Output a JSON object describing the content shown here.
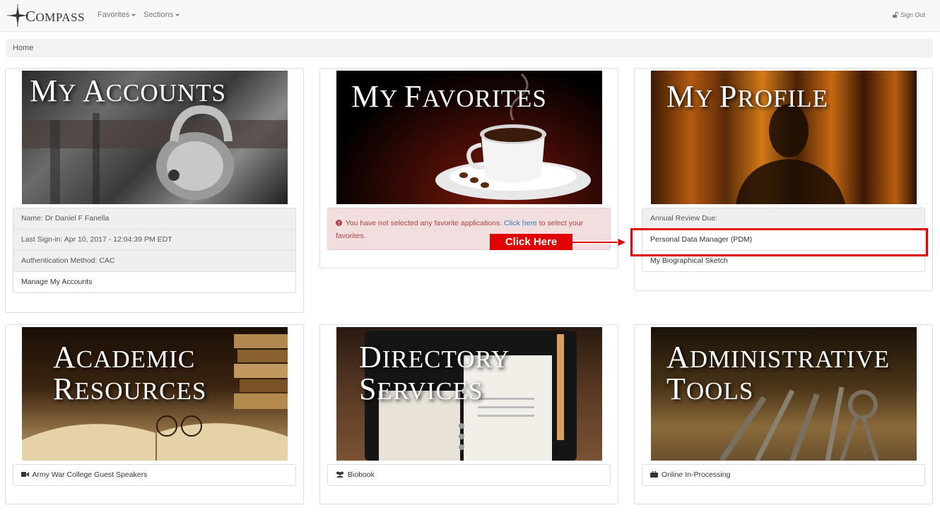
{
  "navbar": {
    "brand_first": "C",
    "brand_rest": "OMPASS",
    "menu_favorites": "Favorites",
    "menu_sections": "Sections",
    "signout": "Sign Out"
  },
  "breadcrumb": {
    "home": "Home"
  },
  "panels": {
    "accounts": {
      "title": "My Accounts",
      "name": "Name: Dr Daniel F Fanella",
      "last_signin": "Last Sign-in: Apr 10, 2017 - 12:04:39 PM EDT",
      "auth": "Authentication Method: CAC",
      "manage": "Manage My Accounts"
    },
    "favorites": {
      "title": "My Favorites",
      "alert_pre": "You have not selected any favorite applications.",
      "alert_link": "Click here",
      "alert_post": "to select your favorites."
    },
    "profile": {
      "title": "My Profile",
      "annual_review": "Annual Review Due:",
      "pdm": "Personal Data Manager (PDM)",
      "bio": "My Biographical Sketch"
    },
    "academic": {
      "title": "Academic\nResources",
      "item": "Army War College Guest Speakers"
    },
    "directory": {
      "title": "Directory\nServices",
      "item": "Biobook"
    },
    "admin": {
      "title": "Administrative\nTools",
      "item": "Online In-Processing"
    }
  },
  "annotation": {
    "label": "Click Here",
    "color": "#e00000"
  },
  "icons": [
    "compass-star-icon",
    "lock-icon",
    "exclamation-circle-icon",
    "video-camera-icon",
    "users-icon",
    "briefcase-icon",
    "right-arrow-icon"
  ]
}
